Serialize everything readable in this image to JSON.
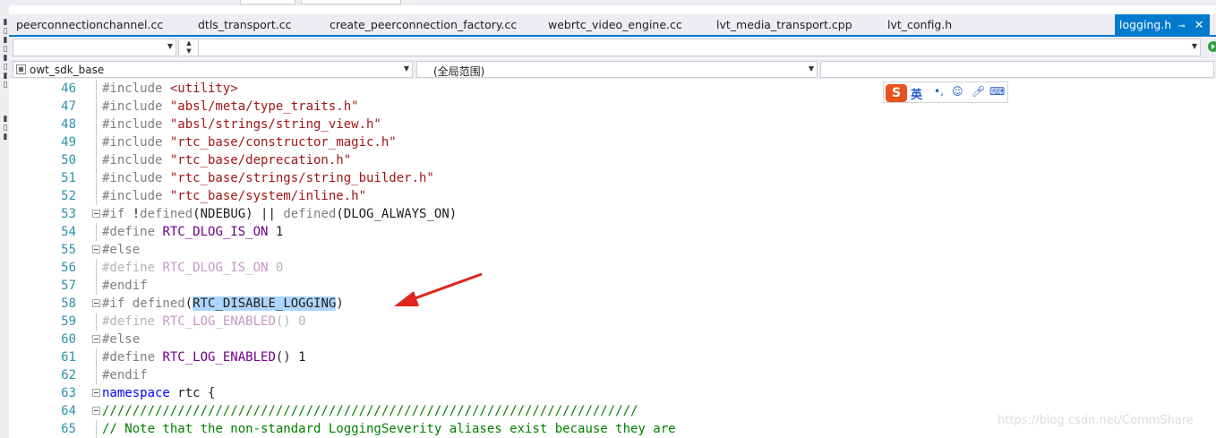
{
  "tabs": [
    {
      "label": "peerconnectionchannel.cc"
    },
    {
      "label": "dtls_transport.cc"
    },
    {
      "label": "create_peerconnection_factory.cc"
    },
    {
      "label": "webrtc_video_engine.cc"
    },
    {
      "label": "lvt_media_transport.cpp"
    },
    {
      "label": "lvt_config.h"
    },
    {
      "label": "logging.h",
      "active": true
    }
  ],
  "toolbar": {
    "project_label": "owt_sdk_base",
    "scope_label": "(全局范围)",
    "member_label": ""
  },
  "ime": {
    "logo": "S",
    "lang": "英"
  },
  "watermark": "https://blog.csdn.net/CommShare",
  "colors": {
    "tab_active": "#007acc",
    "line_number": "#2b91af",
    "string": "#a31515",
    "macro": "#6f008a",
    "keyword": "#0000ff",
    "comment": "#008000",
    "highlight": "#add6ff",
    "arrow": "#e0241c"
  },
  "editor": {
    "lines": [
      {
        "num": "46",
        "parts": [
          {
            "t": "#include ",
            "c": "pp"
          },
          {
            "t": "<utility>",
            "c": "str"
          }
        ]
      },
      {
        "num": "47",
        "parts": [
          {
            "t": "#include ",
            "c": "pp"
          },
          {
            "t": "\"absl/meta/type_traits.h\"",
            "c": "str"
          }
        ]
      },
      {
        "num": "48",
        "parts": [
          {
            "t": "#include ",
            "c": "pp"
          },
          {
            "t": "\"absl/strings/string_view.h\"",
            "c": "str"
          }
        ]
      },
      {
        "num": "49",
        "parts": [
          {
            "t": "#include ",
            "c": "pp"
          },
          {
            "t": "\"rtc_base/constructor_magic.h\"",
            "c": "str"
          }
        ]
      },
      {
        "num": "50",
        "parts": [
          {
            "t": "#include ",
            "c": "pp"
          },
          {
            "t": "\"rtc_base/deprecation.h\"",
            "c": "str"
          }
        ]
      },
      {
        "num": "51",
        "parts": [
          {
            "t": "#include ",
            "c": "pp"
          },
          {
            "t": "\"rtc_base/strings/string_builder.h\"",
            "c": "str"
          }
        ]
      },
      {
        "num": "52",
        "parts": [
          {
            "t": "#include ",
            "c": "pp"
          },
          {
            "t": "\"rtc_base/system/inline.h\"",
            "c": "str"
          }
        ]
      },
      {
        "num": "53",
        "fold": true,
        "parts": [
          {
            "t": "#if ",
            "c": "pp"
          },
          {
            "t": "!",
            "c": ""
          },
          {
            "t": "defined",
            "c": "pp"
          },
          {
            "t": "(NDEBUG) || ",
            "c": ""
          },
          {
            "t": "defined",
            "c": "pp"
          },
          {
            "t": "(DLOG_ALWAYS_ON)",
            "c": ""
          }
        ]
      },
      {
        "num": "54",
        "parts": [
          {
            "t": "#define ",
            "c": "pp"
          },
          {
            "t": "RTC_DLOG_IS_ON",
            "c": "mac"
          },
          {
            "t": " 1",
            "c": ""
          }
        ]
      },
      {
        "num": "55",
        "fold": true,
        "parts": [
          {
            "t": "#else",
            "c": "pp"
          }
        ]
      },
      {
        "num": "56",
        "parts": [
          {
            "t": "#define ",
            "c": "dim"
          },
          {
            "t": "RTC_DLOG_IS_ON",
            "c": "dimm"
          },
          {
            "t": " 0",
            "c": "dim"
          }
        ]
      },
      {
        "num": "57",
        "parts": [
          {
            "t": "#endif",
            "c": "pp"
          }
        ]
      },
      {
        "num": "58",
        "fold": true,
        "parts": [
          {
            "t": "#if ",
            "c": "pp"
          },
          {
            "t": "defined",
            "c": "pp"
          },
          {
            "t": "(",
            "c": ""
          },
          {
            "t": "RTC_DISABLE_LOGGING",
            "c": "hl"
          },
          {
            "t": ")",
            "c": ""
          }
        ]
      },
      {
        "num": "59",
        "parts": [
          {
            "t": "#define ",
            "c": "dim"
          },
          {
            "t": "RTC_LOG_ENABLED",
            "c": "dimm"
          },
          {
            "t": "() 0",
            "c": "dim"
          }
        ]
      },
      {
        "num": "60",
        "fold": true,
        "parts": [
          {
            "t": "#else",
            "c": "pp"
          }
        ]
      },
      {
        "num": "61",
        "parts": [
          {
            "t": "#define ",
            "c": "pp"
          },
          {
            "t": "RTC_LOG_ENABLED",
            "c": "mac"
          },
          {
            "t": "() 1",
            "c": ""
          }
        ]
      },
      {
        "num": "62",
        "parts": [
          {
            "t": "#endif",
            "c": "pp"
          }
        ]
      },
      {
        "num": "63",
        "fold": true,
        "parts": [
          {
            "t": "namespace",
            "c": "kw"
          },
          {
            "t": " rtc {",
            "c": ""
          }
        ]
      },
      {
        "num": "64",
        "fold": true,
        "parts": [
          {
            "t": "///////////////////////////////////////////////////////////////////////",
            "c": "cm"
          }
        ]
      },
      {
        "num": "65",
        "parts": [
          {
            "t": "// Note that the non-standard LoggingSeverity aliases exist because they are",
            "c": "cm"
          }
        ]
      }
    ]
  }
}
